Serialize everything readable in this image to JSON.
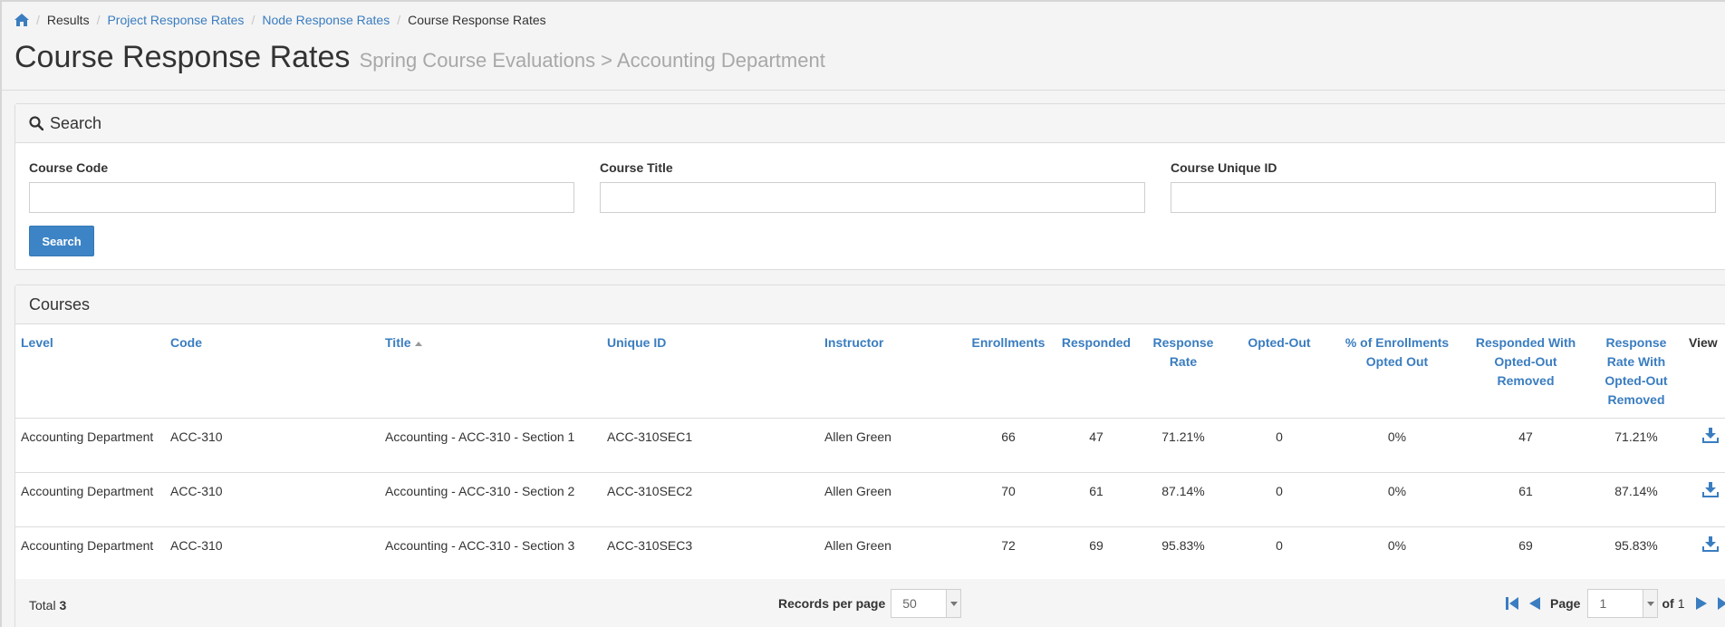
{
  "breadcrumb": {
    "items": [
      {
        "label": "Results",
        "link": false
      },
      {
        "label": "Project Response Rates",
        "link": true
      },
      {
        "label": "Node Response Rates",
        "link": true
      },
      {
        "label": "Course Response Rates",
        "link": false
      }
    ]
  },
  "heading": {
    "title": "Course Response Rates",
    "subtitle": "Spring Course Evaluations > Accounting Department"
  },
  "search": {
    "header": "Search",
    "fields": {
      "course_code": {
        "label": "Course Code",
        "value": ""
      },
      "course_title": {
        "label": "Course Title",
        "value": ""
      },
      "course_unique_id": {
        "label": "Course Unique ID",
        "value": ""
      }
    },
    "button_label": "Search"
  },
  "courses": {
    "header": "Courses",
    "columns": [
      {
        "key": "level",
        "label": "Level"
      },
      {
        "key": "code",
        "label": "Code"
      },
      {
        "key": "title",
        "label": "Title"
      },
      {
        "key": "unique_id",
        "label": "Unique ID"
      },
      {
        "key": "instructor",
        "label": "Instructor"
      },
      {
        "key": "enrollments",
        "label": "Enrollments"
      },
      {
        "key": "responded",
        "label": "Responded"
      },
      {
        "key": "response_rate",
        "label": "Response Rate"
      },
      {
        "key": "opted_out",
        "label": "Opted-Out"
      },
      {
        "key": "pct_opted_out",
        "label": "% of Enrollments Opted Out"
      },
      {
        "key": "responded_wo",
        "label": "Responded With Opted-Out Removed"
      },
      {
        "key": "rate_wo",
        "label": "Response Rate With Opted-Out Removed"
      },
      {
        "key": "view",
        "label": "View"
      }
    ],
    "rows": [
      {
        "level": "Accounting Department",
        "code": "ACC-310",
        "title": "Accounting - ACC-310 - Section 1",
        "unique_id": "ACC-310SEC1",
        "instructor": "Allen Green",
        "enrollments": "66",
        "responded": "47",
        "response_rate": "71.21%",
        "opted_out": "0",
        "pct_opted_out": "0%",
        "responded_wo": "47",
        "rate_wo": "71.21%"
      },
      {
        "level": "Accounting Department",
        "code": "ACC-310",
        "title": "Accounting - ACC-310 - Section 2",
        "unique_id": "ACC-310SEC2",
        "instructor": "Allen Green",
        "enrollments": "70",
        "responded": "61",
        "response_rate": "87.14%",
        "opted_out": "0",
        "pct_opted_out": "0%",
        "responded_wo": "61",
        "rate_wo": "87.14%"
      },
      {
        "level": "Accounting Department",
        "code": "ACC-310",
        "title": "Accounting - ACC-310 - Section 3",
        "unique_id": "ACC-310SEC3",
        "instructor": "Allen Green",
        "enrollments": "72",
        "responded": "69",
        "response_rate": "95.83%",
        "opted_out": "0",
        "pct_opted_out": "0%",
        "responded_wo": "69",
        "rate_wo": "95.83%"
      }
    ]
  },
  "footer": {
    "total_label": "Total",
    "total_value": "3",
    "records_per_page_label": "Records per page",
    "records_per_page_value": "50",
    "page_label": "Page",
    "page_value": "1",
    "of_label": "of",
    "page_count": "1"
  },
  "colors": {
    "link": "#3a7dc0",
    "button": "#3d84c6"
  },
  "icons": [
    "home-icon",
    "search-icon",
    "download-icon",
    "first-page-icon",
    "prev-page-icon",
    "next-page-icon",
    "last-page-icon",
    "chevron-down-icon"
  ]
}
